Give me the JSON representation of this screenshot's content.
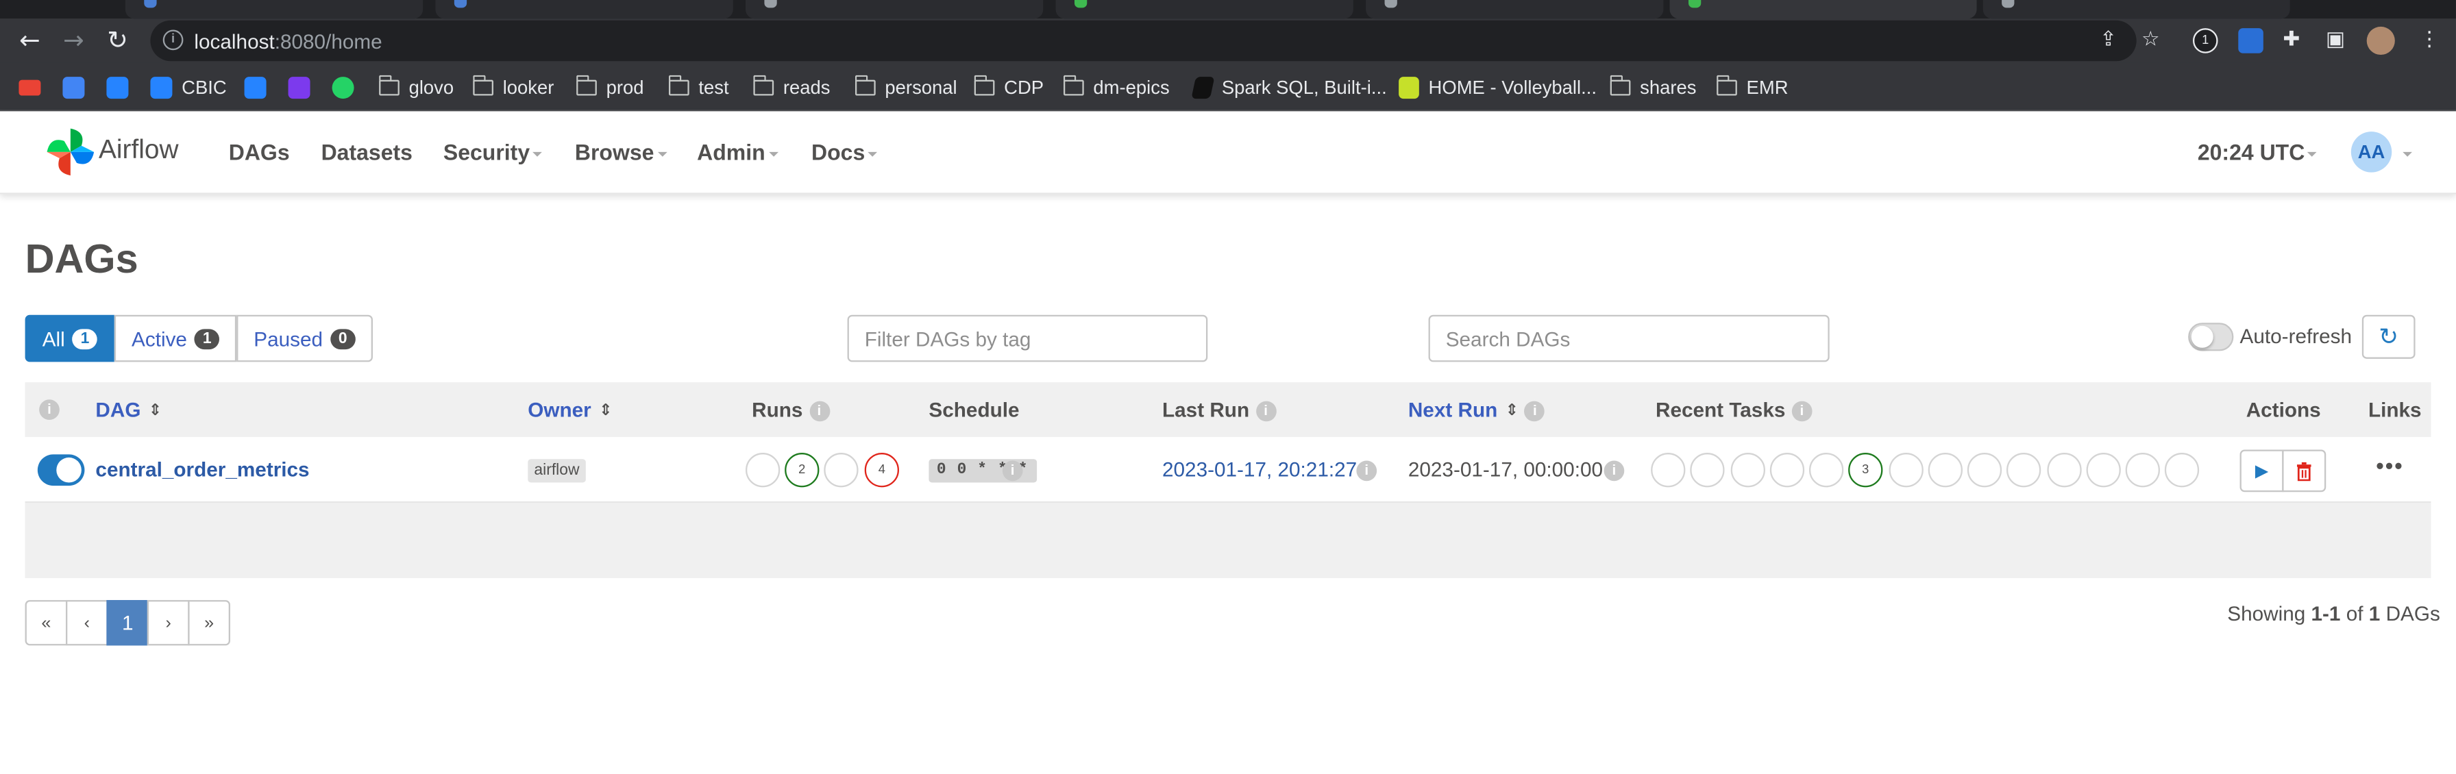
{
  "browser": {
    "url_host": "localhost",
    "url_rest": ":8080/home",
    "bookmarks": [
      {
        "label": ""
      },
      {
        "label": ""
      },
      {
        "label": ""
      },
      {
        "label": "CBIC"
      },
      {
        "label": ""
      },
      {
        "label": ""
      },
      {
        "label": ""
      },
      {
        "label": "glovo"
      },
      {
        "label": "looker"
      },
      {
        "label": "prod"
      },
      {
        "label": "test"
      },
      {
        "label": "reads"
      },
      {
        "label": "personal"
      },
      {
        "label": "CDP"
      },
      {
        "label": "dm-epics"
      },
      {
        "label": "Spark SQL, Built-i..."
      },
      {
        "label": "HOME - Volleyball..."
      },
      {
        "label": "shares"
      },
      {
        "label": "EMR"
      }
    ]
  },
  "navbar": {
    "brand": "Airflow",
    "menu": [
      "DAGs",
      "Datasets",
      "Security",
      "Browse",
      "Admin",
      "Docs"
    ],
    "time": "20:24 UTC",
    "avatar": "AA"
  },
  "page": {
    "title": "DAGs",
    "filters": [
      {
        "label": "All",
        "count": "1"
      },
      {
        "label": "Active",
        "count": "1"
      },
      {
        "label": "Paused",
        "count": "0"
      }
    ],
    "tag_placeholder": "Filter DAGs by tag",
    "search_placeholder": "Search DAGs",
    "autorefresh_label": "Auto-refresh"
  },
  "table": {
    "headers": {
      "dag": "DAG",
      "owner": "Owner",
      "runs": "Runs",
      "schedule": "Schedule",
      "last_run": "Last Run",
      "next_run": "Next Run",
      "recent_tasks": "Recent Tasks",
      "actions": "Actions",
      "links": "Links"
    },
    "rows": [
      {
        "dag_id": "central_order_metrics",
        "owner": "airflow",
        "runs": [
          "",
          "2",
          "",
          "4"
        ],
        "schedule": "0 0 * * *",
        "last_run": "2023-01-17, 20:21:27",
        "next_run": "2023-01-17, 00:00:00",
        "recent_tasks_success": "3"
      }
    ]
  },
  "pagination": {
    "first": "«",
    "prev": "‹",
    "current": "1",
    "next": "›",
    "last": "»"
  },
  "footer": {
    "showing_prefix": "Showing ",
    "showing_range": "1-1",
    "showing_of": " of ",
    "showing_total": "1",
    "showing_suffix": " DAGs"
  },
  "colors": {
    "accent": "#217ac0",
    "link": "#2c5aa6",
    "success": "#1e7b1e",
    "failed": "#e0251b",
    "browser_chrome": "#35363a"
  }
}
